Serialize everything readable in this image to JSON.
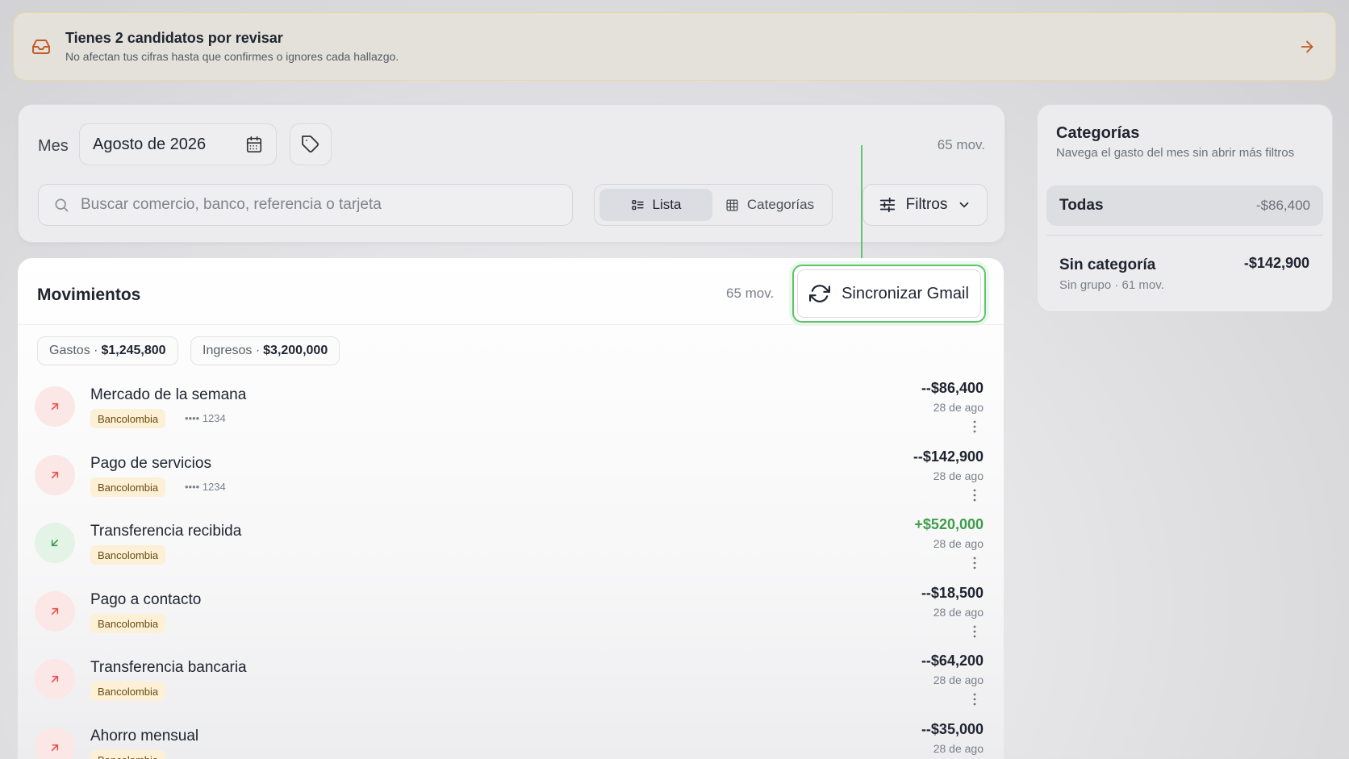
{
  "banner": {
    "title": "Tienes 2 candidatos por revisar",
    "subtitle": "No afectan tus cifras hasta que confirmes o ignores cada hallazgo.",
    "icon": "inbox-icon",
    "accent": "#c25b2a"
  },
  "toolbar": {
    "month_label": "Mes",
    "month_value": "Agosto de 2026",
    "count": "65 mov.",
    "search_placeholder": "Buscar comercio, banco, referencia o tarjeta",
    "views": [
      {
        "label": "Lista",
        "active": true
      },
      {
        "label": "Categorías",
        "active": false
      }
    ],
    "filters_label": "Filtros"
  },
  "movements": {
    "title": "Movimientos",
    "count": "65 mov.",
    "sync_label": "Sincronizar Gmail",
    "summary": {
      "expenses_label": "Gastos ·",
      "expenses_value": "$1,245,800",
      "income_label": "Ingresos ·",
      "income_value": "$3,200,000"
    },
    "rows": [
      {
        "name": "Mercado de la semana",
        "bank": "Bancolombia",
        "card": "•••• 1234",
        "amount": "--$86,400",
        "date": "28 de ago",
        "direction": "out"
      },
      {
        "name": "Pago de servicios",
        "bank": "Bancolombia",
        "card": "•••• 1234",
        "amount": "--$142,900",
        "date": "28 de ago",
        "direction": "out"
      },
      {
        "name": "Transferencia recibida",
        "bank": "Bancolombia",
        "card": "",
        "amount": "+$520,000",
        "date": "28 de ago",
        "direction": "in"
      },
      {
        "name": "Pago a contacto",
        "bank": "Bancolombia",
        "card": "",
        "amount": "--$18,500",
        "date": "28 de ago",
        "direction": "out"
      },
      {
        "name": "Transferencia bancaria",
        "bank": "Bancolombia",
        "card": "",
        "amount": "--$64,200",
        "date": "28 de ago",
        "direction": "out"
      },
      {
        "name": "Ahorro mensual",
        "bank": "Bancolombia",
        "card": "",
        "amount": "--$35,000",
        "date": "28 de ago",
        "direction": "out"
      }
    ]
  },
  "categories": {
    "title": "Categorías",
    "subtitle": "Navega el gasto del mes sin abrir más filtros",
    "all_label": "Todas",
    "all_amount": "-$86,400",
    "items": [
      {
        "name": "Sin categoría",
        "meta": "Sin grupo · 61 mov.",
        "amount": "-$142,900"
      }
    ]
  },
  "colors": {
    "highlight": "#5fc46a",
    "expense": "#e5534b",
    "income": "#3e9c4b",
    "bank_badge_bg": "#fcf1d6"
  }
}
